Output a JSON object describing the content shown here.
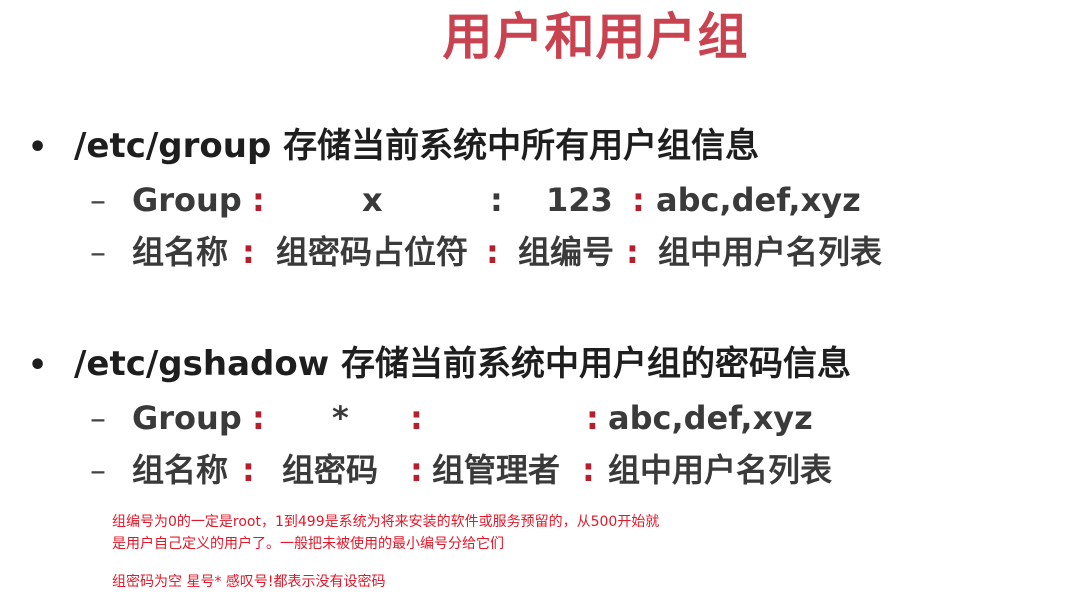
{
  "title": "用户和用户组",
  "section1": {
    "bullet": "•",
    "heading": "/etc/group 存储当前系统中所有用户组信息",
    "row1": {
      "dash": "–",
      "group": "Group",
      "c1": ":",
      "x": "x",
      "c2": ":",
      "num": "123",
      "c3": ":",
      "users": "abc,def,xyz"
    },
    "row2": {
      "dash": "–",
      "name": "组名称",
      "c1": ":",
      "pwd": "组密码占位符",
      "c2": ":",
      "gid": "组编号",
      "c3": ":",
      "list": "组中用户名列表"
    }
  },
  "section2": {
    "bullet": "•",
    "heading": "/etc/gshadow 存储当前系统中用户组的密码信息",
    "row1": {
      "dash": "–",
      "group": "Group",
      "c1": ":",
      "star": "*",
      "c2": ":",
      "c3": ":",
      "users": "abc,def,xyz"
    },
    "row2": {
      "dash": "–",
      "name": "组名称",
      "c1": ":",
      "pwd": "组密码",
      "c2": ":",
      "admin": "组管理者",
      "c3": ":",
      "list": "组中用户名列表"
    }
  },
  "notes": {
    "line1": "组编号为0的一定是root，1到499是系统为将来安装的软件或服务预留的，从500开始就",
    "line2": "是用户自己定义的用户了。一般把未被使用的最小编号分给它们",
    "line3": "组密码为空 星号* 感叹号!都表示没有设密码"
  },
  "colors": {
    "title": "#c8424f",
    "colon": "#b51e2a",
    "note": "#e0182a"
  }
}
